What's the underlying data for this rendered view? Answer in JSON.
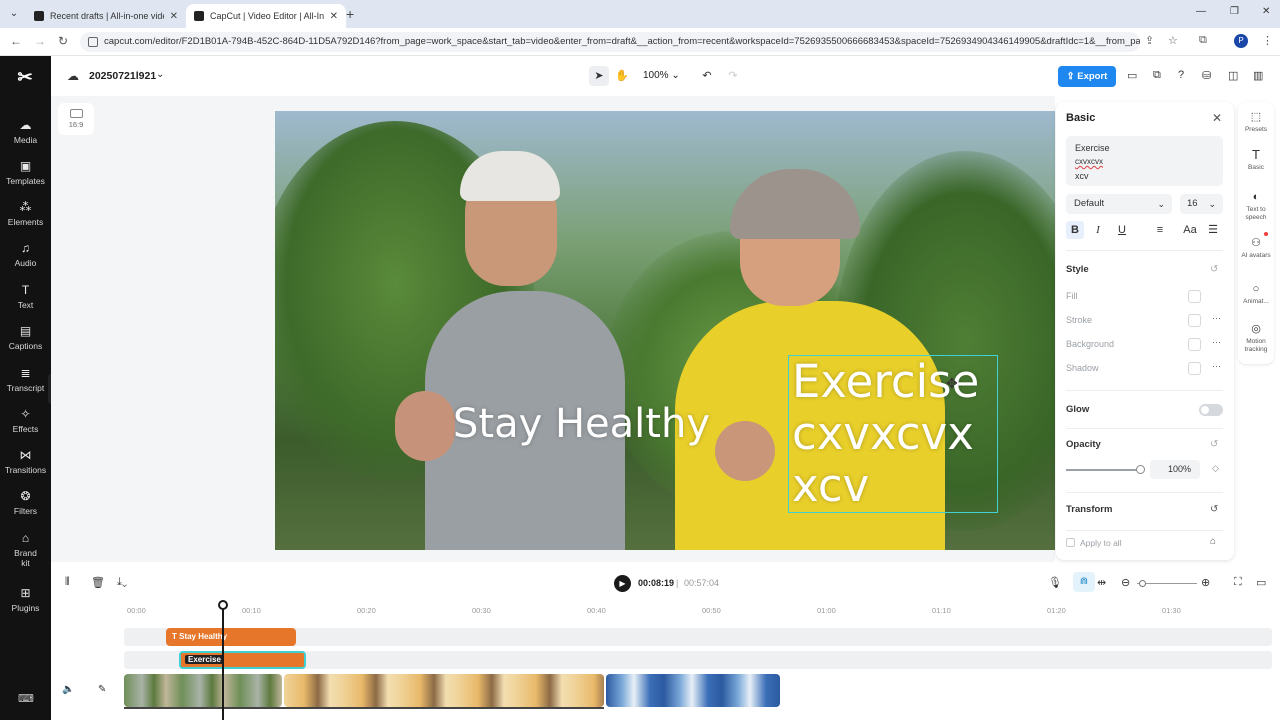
{
  "browser": {
    "tabs": [
      {
        "title": "Recent drafts | All-in-one video",
        "active": false
      },
      {
        "title": "CapCut | Video Editor | All-In-C",
        "active": true
      }
    ],
    "url": "capcut.com/editor/F2D1B01A-794B-452C-864D-11D5A792D146?from_page=work_space&start_tab=video&enter_from=draft&__action_from=recent&workspaceId=7526935500666683453&spaceId=7526934904346149905&draftIdc=1&__from_page...",
    "profile_initial": "P"
  },
  "sidebar": {
    "items": [
      {
        "label": "Media",
        "icon": "cloud-icon"
      },
      {
        "label": "Templates",
        "icon": "templates-icon"
      },
      {
        "label": "Elements",
        "icon": "elements-icon"
      },
      {
        "label": "Audio",
        "icon": "music-icon"
      },
      {
        "label": "Text",
        "icon": "text-icon"
      },
      {
        "label": "Captions",
        "icon": "captions-icon"
      },
      {
        "label": "Transcript",
        "icon": "transcript-icon"
      },
      {
        "label": "Effects",
        "icon": "effects-icon"
      },
      {
        "label": "Transitions",
        "icon": "transitions-icon"
      },
      {
        "label": "Filters",
        "icon": "filters-icon"
      },
      {
        "label": "Brand kit",
        "icon": "brand-kit-icon"
      },
      {
        "label": "Plugins",
        "icon": "plugins-icon"
      }
    ]
  },
  "topbar": {
    "project_name": "20250721l921",
    "zoom": "100%",
    "export_label": "Export",
    "accent_color": "#1e88f0"
  },
  "canvas": {
    "aspect_ratio": "16:9",
    "overlay_text_1": "Stay Healthy",
    "overlay_text_2_lines": [
      "Exercise",
      "cxvxcvx",
      "xcv"
    ]
  },
  "panel": {
    "title": "Basic",
    "text_lines": [
      "Exercise",
      "cxvxcvx",
      "xcv"
    ],
    "font": "Default",
    "font_size": "16",
    "style_section": "Style",
    "style_props": [
      "Fill",
      "Stroke",
      "Background",
      "Shadow"
    ],
    "glow_label": "Glow",
    "glow_enabled": false,
    "opacity_label": "Opacity",
    "opacity_value": "100%",
    "transform_label": "Transform",
    "apply_all_label": "Apply to all"
  },
  "rail": {
    "items": [
      {
        "label": "Presets",
        "icon": "presets-icon"
      },
      {
        "label": "Basic",
        "icon": "text-t-icon"
      },
      {
        "label": "Text to speech",
        "icon": "tts-icon"
      },
      {
        "label": "AI avatars",
        "icon": "ai-avatar-icon"
      },
      {
        "label": "Animat...",
        "icon": "animation-icon"
      },
      {
        "label": "Motion tracking",
        "icon": "motion-tracking-icon"
      }
    ]
  },
  "timeline": {
    "current_time": "00:08:19",
    "separator": "|",
    "total_time": "00:57:04",
    "ruler_labels": [
      "00:00",
      "00:10",
      "00:20",
      "00:30",
      "00:40",
      "00:50",
      "01:00",
      "01:10",
      "01:20",
      "01:30"
    ],
    "text_clips": [
      "Stay Healthy",
      "Exercise"
    ]
  }
}
